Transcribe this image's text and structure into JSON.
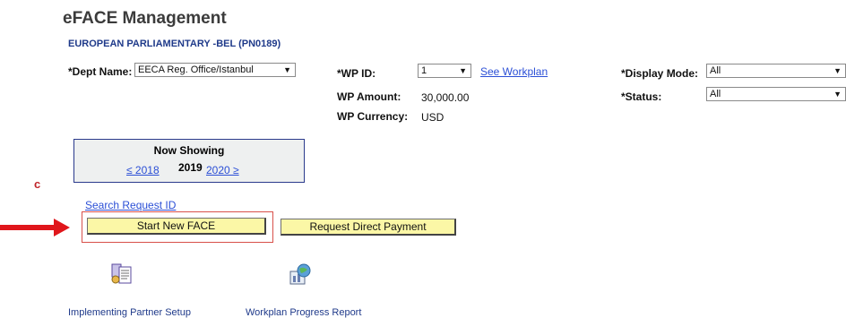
{
  "header": {
    "title": "eFACE Management",
    "subtitle": "EUROPEAN PARLIAMENTARY -BEL (PN0189)"
  },
  "filters": {
    "dept_label": "*Dept Name:",
    "dept_value": "EECA Reg. Office/Istanbul",
    "wp_id_label": "*WP ID:",
    "wp_id_value": "1",
    "see_workplan": "See Workplan",
    "wp_amount_label": "WP Amount:",
    "wp_amount_value": "30,000.00",
    "wp_currency_label": "WP Currency:",
    "wp_currency_value": "USD",
    "display_mode_label": "*Display Mode:",
    "display_mode_value": "All",
    "status_label": "*Status:",
    "status_value": "All"
  },
  "now_showing": {
    "header": "Now Showing",
    "prev_year": "≤ 2018",
    "current_year": "2019",
    "next_year": "2020 ≥"
  },
  "annotation": {
    "marker": "c"
  },
  "actions": {
    "search_request_id": "Search Request ID",
    "start_new_face": "Start New FACE",
    "request_direct_payment": "Request Direct Payment"
  },
  "tiles": [
    {
      "label": "Implementing Partner Setup",
      "icon": "partner-setup-icon"
    },
    {
      "label": "Workplan Progress Report",
      "icon": "progress-report-icon"
    }
  ],
  "colors": {
    "button_bg": "#fbf7a6",
    "link": "#2b4fd6",
    "highlight_red": "#e0161b"
  }
}
